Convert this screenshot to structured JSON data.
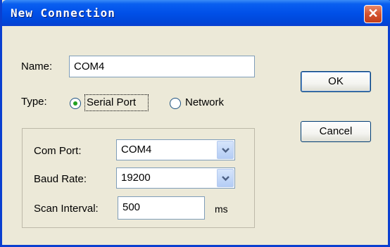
{
  "window": {
    "title": "New Connection"
  },
  "name": {
    "label": "Name:",
    "value": "COM4"
  },
  "type": {
    "label": "Type:",
    "options": [
      {
        "label": "Serial Port",
        "selected": true
      },
      {
        "label": "Network",
        "selected": false
      }
    ]
  },
  "serial": {
    "com_port": {
      "label": "Com Port:",
      "value": "COM4"
    },
    "baud_rate": {
      "label": "Baud Rate:",
      "value": "19200"
    },
    "scan_interval": {
      "label": "Scan Interval:",
      "value": "500",
      "unit": "ms"
    }
  },
  "buttons": {
    "ok": "OK",
    "cancel": "Cancel"
  },
  "colors": {
    "title_bar": "#0050e8",
    "close_button": "#d4532f",
    "dialog_bg": "#ece9d8"
  }
}
